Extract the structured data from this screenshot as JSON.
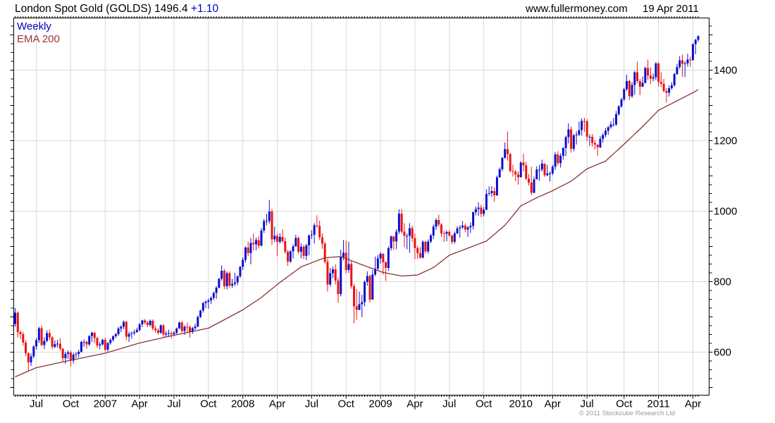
{
  "header": {
    "title_main": "London Spot Gold (GOLDS) 1496.4 ",
    "change": "+1.10",
    "website": "www.fullermoney.com",
    "date": "19 Apr 2011"
  },
  "legend": {
    "timeframe": "Weekly",
    "overlay": "EMA 200"
  },
  "footer": {
    "copyright": "© 2011 Stockcube Research Ltd"
  },
  "colors": {
    "up": "#0d0dcc",
    "down": "#ee1111",
    "ema": "#8b3232",
    "grid": "#d9d9d9",
    "frame": "#000000",
    "legend_weekly": "#0000bb",
    "legend_ema": "#993333",
    "change": "#0000cc",
    "copyright": "#999999"
  },
  "chart_data": {
    "type": "candlestick",
    "title": "London Spot Gold (GOLDS)",
    "last_price": 1496.4,
    "change": 1.1,
    "timeframe": "Weekly",
    "overlay": "EMA 200",
    "ylim": [
      478,
      1548
    ],
    "yticks": [
      600,
      800,
      1000,
      1200,
      1400
    ],
    "ytick_minor_step": 25,
    "grid": true,
    "xticks": [
      {
        "week": 8,
        "label": "Jul"
      },
      {
        "week": 21,
        "label": "Oct"
      },
      {
        "week": 34,
        "label": "2007"
      },
      {
        "week": 47,
        "label": "Apr"
      },
      {
        "week": 60,
        "label": "Jul"
      },
      {
        "week": 73,
        "label": "Oct"
      },
      {
        "week": 86,
        "label": "2008"
      },
      {
        "week": 99,
        "label": "Apr"
      },
      {
        "week": 112,
        "label": "Jul"
      },
      {
        "week": 125,
        "label": "Oct"
      },
      {
        "week": 138,
        "label": "2009"
      },
      {
        "week": 151,
        "label": "Apr"
      },
      {
        "week": 164,
        "label": "Jul"
      },
      {
        "week": 177,
        "label": "Oct"
      },
      {
        "week": 191,
        "label": "2010"
      },
      {
        "week": 203,
        "label": "Apr"
      },
      {
        "week": 216,
        "label": "Jul"
      },
      {
        "week": 230,
        "label": "Oct"
      },
      {
        "week": 243,
        "label": "2011"
      },
      {
        "week": 256,
        "label": "Apr"
      }
    ],
    "first_open": 680,
    "bars_format": [
      "high",
      "low",
      "close"
    ],
    "bars": [
      [
        725,
        672,
        712
      ],
      [
        716,
        642,
        657
      ],
      [
        662,
        637,
        651
      ],
      [
        658,
        618,
        627
      ],
      [
        634,
        589,
        597
      ],
      [
        599,
        545,
        571
      ],
      [
        596,
        561,
        588
      ],
      [
        619,
        583,
        616
      ],
      [
        640,
        607,
        634
      ],
      [
        672,
        626,
        668
      ],
      [
        676,
        617,
        620
      ],
      [
        642,
        609,
        632
      ],
      [
        662,
        628,
        654
      ],
      [
        664,
        634,
        642
      ],
      [
        645,
        608,
        615
      ],
      [
        633,
        611,
        623
      ],
      [
        635,
        613,
        624
      ],
      [
        640,
        604,
        610
      ],
      [
        611,
        571,
        583
      ],
      [
        601,
        567,
        595
      ],
      [
        605,
        581,
        599
      ],
      [
        604,
        560,
        576
      ],
      [
        598,
        568,
        593
      ],
      [
        600,
        583,
        595
      ],
      [
        607,
        585,
        601
      ],
      [
        632,
        598,
        629
      ],
      [
        636,
        615,
        629
      ],
      [
        633,
        610,
        622
      ],
      [
        648,
        618,
        646
      ],
      [
        658,
        629,
        655
      ],
      [
        657,
        625,
        640
      ],
      [
        644,
        612,
        619
      ],
      [
        629,
        608,
        622
      ],
      [
        638,
        619,
        635
      ],
      [
        641,
        602,
        607
      ],
      [
        628,
        602,
        626
      ],
      [
        639,
        621,
        635
      ],
      [
        648,
        630,
        645
      ],
      [
        655,
        640,
        651
      ],
      [
        672,
        646,
        667
      ],
      [
        676,
        657,
        672
      ],
      [
        690,
        665,
        686
      ],
      [
        689,
        634,
        644
      ],
      [
        658,
        629,
        652
      ],
      [
        659,
        638,
        654
      ],
      [
        664,
        648,
        657
      ],
      [
        669,
        655,
        663
      ],
      [
        682,
        659,
        679
      ],
      [
        692,
        671,
        690
      ],
      [
        694,
        679,
        684
      ],
      [
        688,
        671,
        677
      ],
      [
        693,
        672,
        689
      ],
      [
        693,
        662,
        667
      ],
      [
        675,
        655,
        662
      ],
      [
        668,
        650,
        655
      ],
      [
        679,
        652,
        676
      ],
      [
        679,
        643,
        650
      ],
      [
        660,
        642,
        653
      ],
      [
        664,
        643,
        654
      ],
      [
        659,
        639,
        651
      ],
      [
        660,
        645,
        655
      ],
      [
        670,
        650,
        667
      ],
      [
        687,
        666,
        684
      ],
      [
        688,
        655,
        660
      ],
      [
        677,
        649,
        672
      ],
      [
        684,
        657,
        671
      ],
      [
        676,
        641,
        657
      ],
      [
        672,
        652,
        668
      ],
      [
        681,
        663,
        673
      ],
      [
        704,
        670,
        700
      ],
      [
        720,
        697,
        718
      ],
      [
        743,
        712,
        739
      ],
      [
        747,
        725,
        743
      ],
      [
        752,
        723,
        747
      ],
      [
        758,
        737,
        754
      ],
      [
        772,
        748,
        768
      ],
      [
        787,
        751,
        783
      ],
      [
        811,
        781,
        808
      ],
      [
        846,
        803,
        831
      ],
      [
        836,
        779,
        787
      ],
      [
        829,
        778,
        824
      ],
      [
        829,
        783,
        789
      ],
      [
        808,
        782,
        794
      ],
      [
        825,
        787,
        798
      ],
      [
        818,
        790,
        815
      ],
      [
        845,
        810,
        842
      ],
      [
        869,
        833,
        862
      ],
      [
        900,
        854,
        897
      ],
      [
        914,
        872,
        881
      ],
      [
        924,
        849,
        910
      ],
      [
        936,
        888,
        906
      ],
      [
        925,
        889,
        918
      ],
      [
        929,
        894,
        902
      ],
      [
        952,
        900,
        945
      ],
      [
        978,
        938,
        972
      ],
      [
        992,
        960,
        972
      ],
      [
        1032,
        965,
        999
      ],
      [
        1006,
        904,
        920
      ],
      [
        956,
        912,
        930
      ],
      [
        936,
        872,
        913
      ],
      [
        937,
        908,
        927
      ],
      [
        949,
        910,
        915
      ],
      [
        925,
        879,
        885
      ],
      [
        890,
        845,
        857
      ],
      [
        890,
        853,
        886
      ],
      [
        906,
        866,
        900
      ],
      [
        933,
        899,
        924
      ],
      [
        928,
        879,
        885
      ],
      [
        909,
        866,
        899
      ],
      [
        905,
        864,
        873
      ],
      [
        908,
        861,
        903
      ],
      [
        934,
        875,
        931
      ],
      [
        946,
        921,
        933
      ],
      [
        966,
        908,
        960
      ],
      [
        988,
        953,
        958
      ],
      [
        973,
        918,
        926
      ],
      [
        937,
        893,
        908
      ],
      [
        913,
        851,
        856
      ],
      [
        865,
        772,
        792
      ],
      [
        839,
        786,
        824
      ],
      [
        843,
        810,
        835
      ],
      [
        849,
        792,
        803
      ],
      [
        812,
        740,
        765
      ],
      [
        890,
        758,
        870
      ],
      [
        918,
        861,
        882
      ],
      [
        917,
        823,
        833
      ],
      [
        913,
        825,
        850
      ],
      [
        859,
        780,
        787
      ],
      [
        794,
        682,
        730
      ],
      [
        779,
        692,
        720
      ],
      [
        772,
        719,
        736
      ],
      [
        763,
        699,
        742
      ],
      [
        803,
        730,
        799
      ],
      [
        829,
        789,
        816
      ],
      [
        820,
        741,
        749
      ],
      [
        833,
        752,
        820
      ],
      [
        871,
        816,
        837
      ],
      [
        876,
        832,
        866
      ],
      [
        884,
        851,
        879
      ],
      [
        881,
        820,
        855
      ],
      [
        858,
        802,
        839
      ],
      [
        900,
        830,
        895
      ],
      [
        931,
        888,
        928
      ],
      [
        931,
        890,
        914
      ],
      [
        949,
        892,
        942
      ],
      [
        1005,
        935,
        993
      ],
      [
        1006,
        936,
        942
      ],
      [
        966,
        898,
        930
      ],
      [
        937,
        892,
        930
      ],
      [
        966,
        882,
        952
      ],
      [
        959,
        913,
        923
      ],
      [
        936,
        864,
        895
      ],
      [
        901,
        864,
        881
      ],
      [
        898,
        865,
        868
      ],
      [
        917,
        866,
        913
      ],
      [
        916,
        880,
        886
      ],
      [
        920,
        880,
        914
      ],
      [
        936,
        909,
        931
      ],
      [
        962,
        921,
        956
      ],
      [
        980,
        947,
        975
      ],
      [
        990,
        956,
        962
      ],
      [
        966,
        927,
        937
      ],
      [
        944,
        913,
        936
      ],
      [
        946,
        915,
        941
      ],
      [
        946,
        927,
        931
      ],
      [
        933,
        906,
        913
      ],
      [
        942,
        908,
        937
      ],
      [
        957,
        935,
        951
      ],
      [
        960,
        925,
        954
      ],
      [
        972,
        950,
        959
      ],
      [
        965,
        940,
        948
      ],
      [
        958,
        927,
        954
      ],
      [
        968,
        938,
        958
      ],
      [
        999,
        948,
        997
      ],
      [
        1013,
        988,
        1006
      ],
      [
        1025,
        987,
        1010
      ],
      [
        1018,
        983,
        992
      ],
      [
        1012,
        985,
        1004
      ],
      [
        1062,
        1003,
        1049
      ],
      [
        1070,
        1043,
        1051
      ],
      [
        1071,
        1040,
        1057
      ],
      [
        1067,
        1027,
        1045
      ],
      [
        1101,
        1043,
        1096
      ],
      [
        1124,
        1095,
        1119
      ],
      [
        1154,
        1113,
        1151
      ],
      [
        1195,
        1149,
        1176
      ],
      [
        1226,
        1143,
        1162
      ],
      [
        1165,
        1110,
        1114
      ],
      [
        1132,
        1098,
        1112
      ],
      [
        1117,
        1085,
        1104
      ],
      [
        1113,
        1075,
        1096
      ],
      [
        1141,
        1096,
        1138
      ],
      [
        1163,
        1113,
        1130
      ],
      [
        1140,
        1088,
        1092
      ],
      [
        1105,
        1073,
        1081
      ],
      [
        1126,
        1045,
        1052
      ],
      [
        1098,
        1051,
        1090
      ],
      [
        1127,
        1094,
        1118
      ],
      [
        1131,
        1086,
        1118
      ],
      [
        1146,
        1112,
        1135
      ],
      [
        1135,
        1097,
        1102
      ],
      [
        1131,
        1099,
        1107
      ],
      [
        1113,
        1084,
        1107
      ],
      [
        1131,
        1102,
        1126
      ],
      [
        1168,
        1117,
        1161
      ],
      [
        1170,
        1130,
        1136
      ],
      [
        1164,
        1124,
        1157
      ],
      [
        1182,
        1146,
        1179
      ],
      [
        1214,
        1156,
        1210
      ],
      [
        1249,
        1192,
        1232
      ],
      [
        1240,
        1166,
        1177
      ],
      [
        1219,
        1170,
        1215
      ],
      [
        1226,
        1189,
        1217
      ],
      [
        1254,
        1213,
        1230
      ],
      [
        1263,
        1214,
        1256
      ],
      [
        1265,
        1225,
        1255
      ],
      [
        1261,
        1199,
        1211
      ],
      [
        1218,
        1185,
        1211
      ],
      [
        1219,
        1183,
        1193
      ],
      [
        1201,
        1175,
        1189
      ],
      [
        1189,
        1157,
        1181
      ],
      [
        1213,
        1179,
        1205
      ],
      [
        1221,
        1194,
        1216
      ],
      [
        1236,
        1210,
        1228
      ],
      [
        1242,
        1217,
        1238
      ],
      [
        1255,
        1234,
        1246
      ],
      [
        1264,
        1240,
        1246
      ],
      [
        1284,
        1242,
        1275
      ],
      [
        1301,
        1271,
        1297
      ],
      [
        1322,
        1293,
        1317
      ],
      [
        1350,
        1312,
        1346
      ],
      [
        1387,
        1341,
        1369
      ],
      [
        1373,
        1315,
        1326
      ],
      [
        1366,
        1321,
        1358
      ],
      [
        1398,
        1330,
        1394
      ],
      [
        1424,
        1363,
        1369
      ],
      [
        1375,
        1329,
        1353
      ],
      [
        1382,
        1352,
        1364
      ],
      [
        1410,
        1362,
        1406
      ],
      [
        1430,
        1372,
        1385
      ],
      [
        1408,
        1361,
        1376
      ],
      [
        1391,
        1368,
        1380
      ],
      [
        1423,
        1372,
        1419
      ],
      [
        1423,
        1353,
        1367
      ],
      [
        1394,
        1352,
        1361
      ],
      [
        1375,
        1337,
        1341
      ],
      [
        1349,
        1308,
        1336
      ],
      [
        1357,
        1325,
        1349
      ],
      [
        1366,
        1344,
        1357
      ],
      [
        1392,
        1353,
        1389
      ],
      [
        1418,
        1386,
        1409
      ],
      [
        1440,
        1403,
        1428
      ],
      [
        1444,
        1381,
        1418
      ],
      [
        1426,
        1380,
        1419
      ],
      [
        1447,
        1410,
        1430
      ],
      [
        1438,
        1410,
        1428
      ],
      [
        1476,
        1432,
        1474
      ],
      [
        1489,
        1445,
        1486
      ],
      [
        1499,
        1481,
        1496.4
      ]
    ],
    "ema_anchors": [
      [
        0,
        530
      ],
      [
        8,
        556
      ],
      [
        21,
        577
      ],
      [
        34,
        597
      ],
      [
        47,
        626
      ],
      [
        60,
        648
      ],
      [
        73,
        668
      ],
      [
        86,
        720
      ],
      [
        93,
        755
      ],
      [
        99,
        792
      ],
      [
        108,
        842
      ],
      [
        117,
        868
      ],
      [
        123,
        871
      ],
      [
        131,
        848
      ],
      [
        139,
        826
      ],
      [
        146,
        816
      ],
      [
        152,
        819
      ],
      [
        158,
        840
      ],
      [
        164,
        875
      ],
      [
        171,
        895
      ],
      [
        178,
        915
      ],
      [
        185,
        960
      ],
      [
        191,
        1015
      ],
      [
        197,
        1038
      ],
      [
        203,
        1058
      ],
      [
        210,
        1085
      ],
      [
        216,
        1120
      ],
      [
        223,
        1142
      ],
      [
        230,
        1190
      ],
      [
        237,
        1240
      ],
      [
        243,
        1286
      ],
      [
        250,
        1313
      ],
      [
        256,
        1336
      ],
      [
        258,
        1345
      ]
    ]
  }
}
